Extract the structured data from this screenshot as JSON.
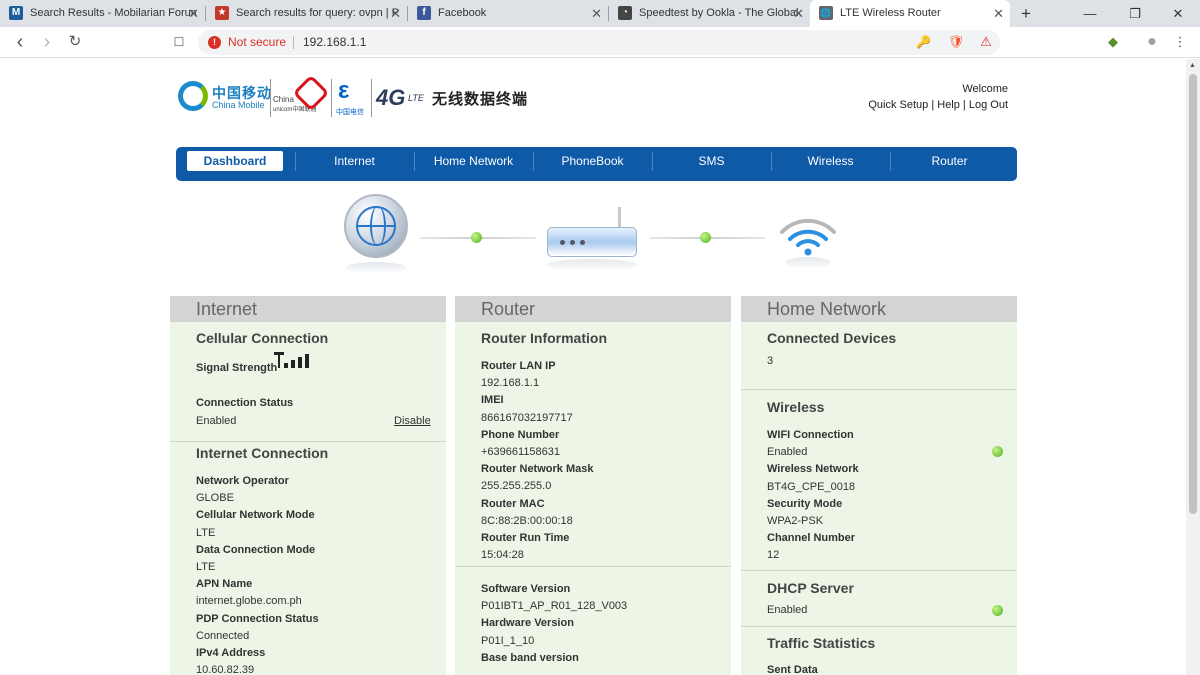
{
  "browser": {
    "tabs": [
      {
        "title": "Search Results - Mobilarian Forum",
        "favicon": "M",
        "favicon_color": "#1d5d9c"
      },
      {
        "title": "Search results for query: ovpn | P",
        "favicon": "★",
        "favicon_color": "#c0392b"
      },
      {
        "title": "Facebook",
        "favicon": "f",
        "favicon_color": "#3b5998"
      },
      {
        "title": "Speedtest by Ookla - The Global",
        "favicon": "◔",
        "favicon_color": "#444444"
      },
      {
        "title": "LTE Wireless Router",
        "favicon": "🌐",
        "favicon_color": "#666666"
      }
    ],
    "new_tab_label": "+",
    "window_controls": {
      "minimize": "—",
      "maximize": "❐",
      "close": "✕"
    },
    "tab_close_glyph": "✕",
    "nav": {
      "back": "‹",
      "forward": "›",
      "reload": "↻",
      "bookmark": "☐"
    },
    "omnibox": {
      "security_text": "Not secure",
      "url": "192.168.1.1"
    },
    "extensions": {
      "key": "🔑",
      "brave": "🛡",
      "alert": "⚠",
      "ext1": "◆",
      "profile": "●",
      "menu": "⋮"
    }
  },
  "header": {
    "logo": {
      "china_mobile_cn": "中国移动",
      "china_mobile_en": "China Mobile",
      "china_unicom_en_1": "China",
      "china_unicom_en_2": "unicom中国联通",
      "china_telecom_mark": "ε",
      "china_telecom_cn": "中国电信",
      "four_g": "4G",
      "lte": "LTE",
      "product_title": "无线数据终端"
    },
    "welcome": "Welcome",
    "links": {
      "quick_setup": "Quick Setup",
      "sep1": " | ",
      "help": "Help",
      "sep2": " | ",
      "logout": "Log Out"
    }
  },
  "nav": {
    "items": [
      "Dashboard",
      "Internet",
      "Home Network",
      "PhoneBook",
      "SMS",
      "Wireless",
      "Router"
    ],
    "active_index": 0
  },
  "colors": {
    "nav_bg": "#0e5aa7",
    "panel_bg": "#ecf5e6",
    "panel_head": "#d4d4d4",
    "status_green": "#4caf1a"
  },
  "panels": {
    "internet": {
      "title": "Internet",
      "cellular": {
        "title": "Cellular Connection",
        "signal_label": "Signal Strength",
        "signal_level": 4,
        "status_label": "Connection Status",
        "status_value": "Enabled",
        "disable_link": "Disable"
      },
      "connection": {
        "title": "Internet Connection",
        "rows": [
          {
            "label": "Network Operator",
            "value": "GLOBE"
          },
          {
            "label": "Cellular Network Mode",
            "value": "LTE"
          },
          {
            "label": "Data Connection Mode",
            "value": "LTE"
          },
          {
            "label": "APN Name",
            "value": "internet.globe.com.ph"
          },
          {
            "label": "PDP Connection Status",
            "value": "Connected"
          },
          {
            "label": "IPv4 Address",
            "value": "10.60.82.39"
          }
        ]
      }
    },
    "router": {
      "title": "Router",
      "info": {
        "title": "Router Information",
        "rows": [
          {
            "label": "Router LAN IP",
            "value": "192.168.1.1"
          },
          {
            "label": "IMEI",
            "value": "866167032197717"
          },
          {
            "label": "Phone Number",
            "value": "+639661158631"
          },
          {
            "label": "Router Network Mask",
            "value": "255.255.255.0"
          },
          {
            "label": "Router MAC",
            "value": "8C:88:2B:00:00:18"
          },
          {
            "label": "Router Run Time",
            "value": "15:04:28"
          }
        ]
      },
      "versions": {
        "rows": [
          {
            "label": "Software Version",
            "value": "P01IBT1_AP_R01_128_V003"
          },
          {
            "label": "Hardware Version",
            "value": "P01I_1_10"
          },
          {
            "label": "Base band version",
            "value": ""
          }
        ]
      }
    },
    "home": {
      "title": "Home Network",
      "devices": {
        "title": "Connected Devices",
        "value": "3"
      },
      "wireless": {
        "title": "Wireless",
        "rows": [
          {
            "label": "WIFI Connection",
            "value": "Enabled"
          },
          {
            "label": "Wireless Network",
            "value": "BT4G_CPE_0018"
          },
          {
            "label": "Security Mode",
            "value": "WPA2-PSK"
          },
          {
            "label": "Channel Number",
            "value": "12"
          }
        ]
      },
      "dhcp": {
        "title": "DHCP Server",
        "value": "Enabled"
      },
      "traffic": {
        "title": "Traffic Statistics",
        "first_label": "Sent Data"
      }
    }
  }
}
